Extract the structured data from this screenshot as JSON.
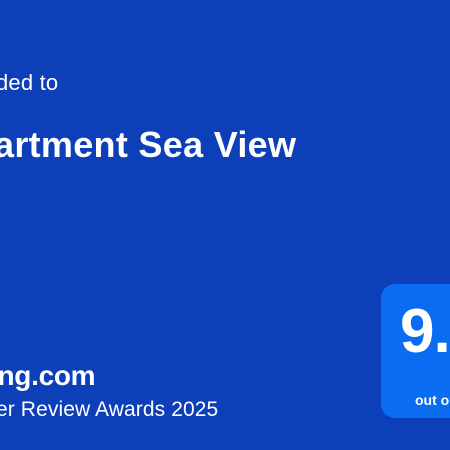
{
  "colors": {
    "background": "#0d3fb8",
    "badge": "#0a6cf0",
    "text": "#ffffff"
  },
  "card": {
    "awarded_text": "ded to",
    "property_name": "artment Sea View",
    "brand": "ing.com",
    "award_name": "er Review Awards 2025"
  },
  "score": {
    "value": "9.",
    "scale": "out o"
  }
}
